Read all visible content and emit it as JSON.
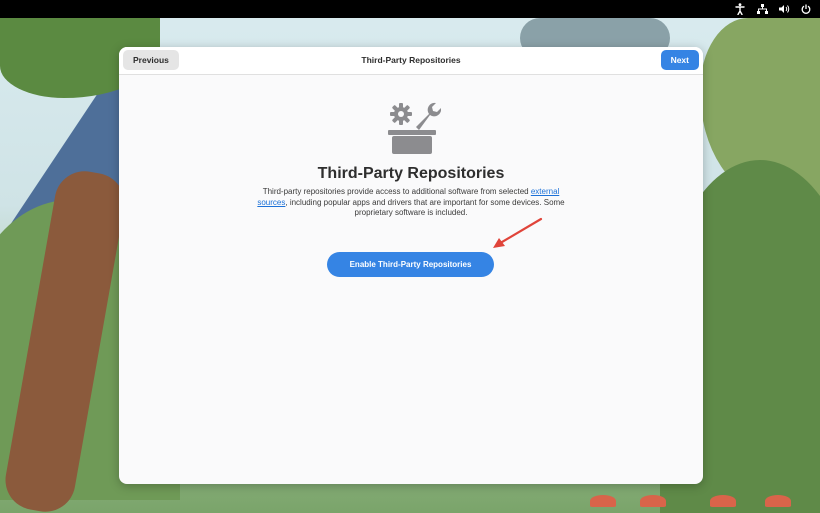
{
  "dialog": {
    "title": "Third-Party Repositories",
    "previous_label": "Previous",
    "next_label": "Next",
    "heading": "Third-Party Repositories",
    "description_before": "Third-party repositories provide access to additional software from selected ",
    "description_link": "external sources",
    "description_after": ", including popular apps and drivers that are important for some devices. Some proprietary software is included.",
    "enable_button_label": "Enable Third-Party Repositories"
  },
  "topbar": {
    "indicators": [
      "accessibility-icon",
      "network-icon",
      "volume-icon",
      "power-icon"
    ]
  },
  "colors": {
    "accent": "#3584e4",
    "link": "#1c71d8",
    "annotation_arrow": "#e0443a"
  }
}
